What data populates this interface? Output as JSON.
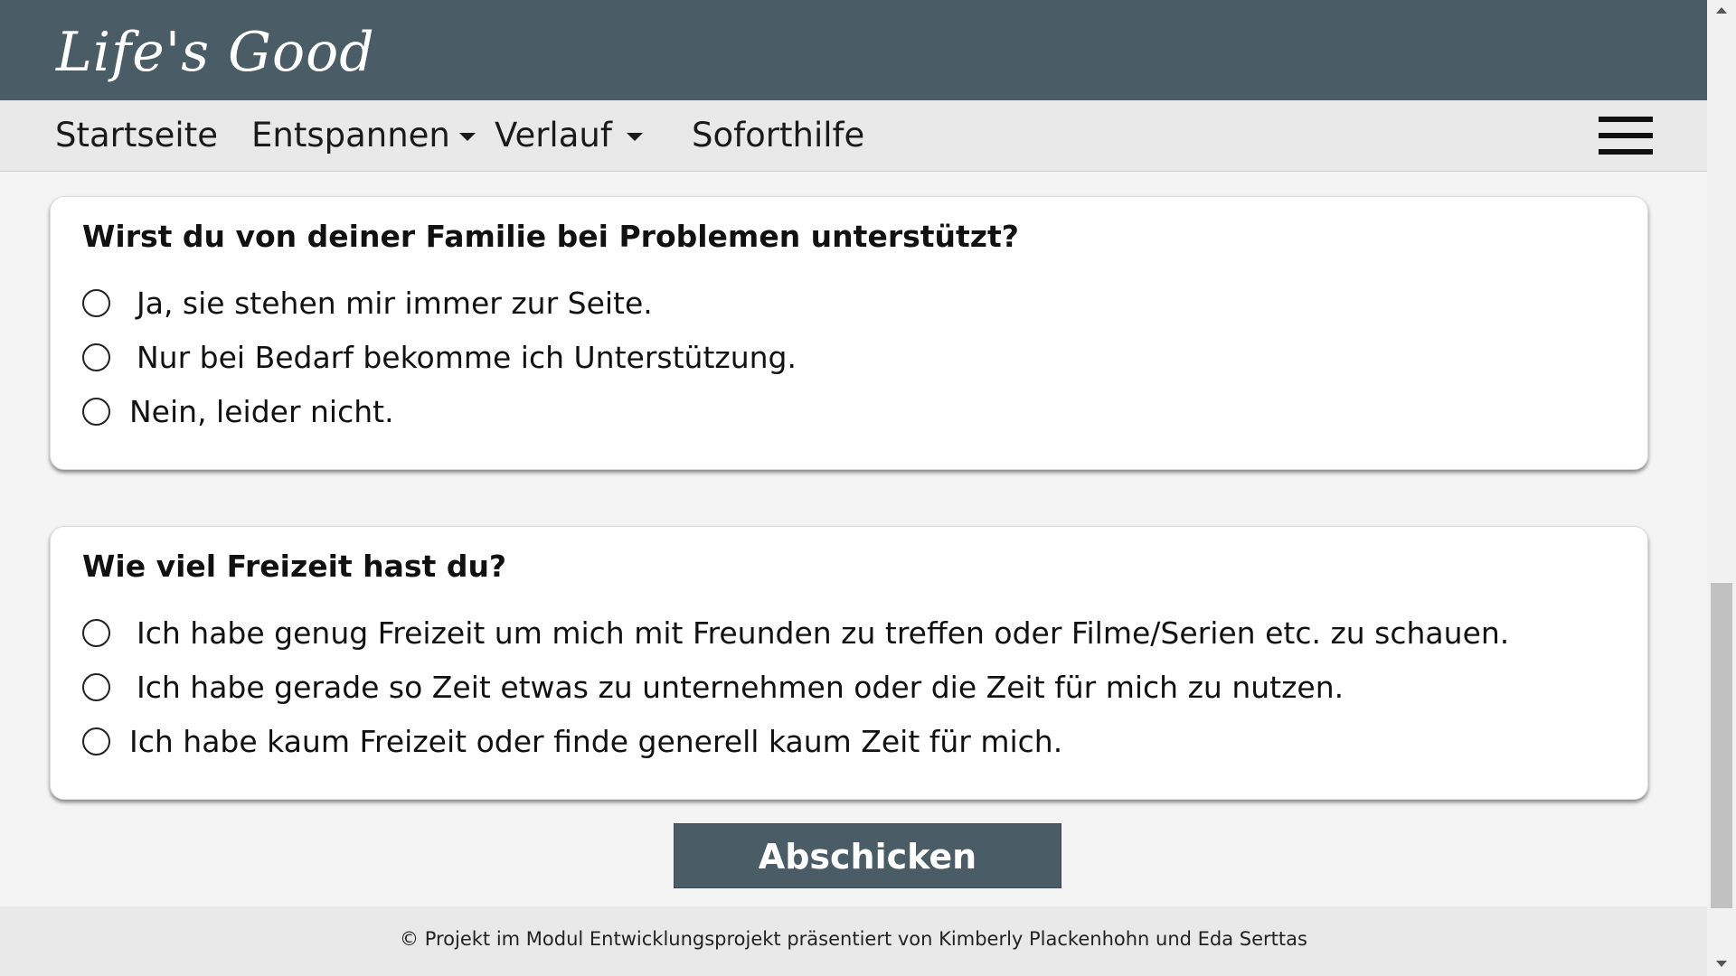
{
  "brand": {
    "logo_text": "Life's Good",
    "header_color": "#4a5d66"
  },
  "nav": {
    "items": [
      {
        "label": "Startseite",
        "has_dropdown": false
      },
      {
        "label": "Entspannen",
        "has_dropdown": true
      },
      {
        "label": "Verlauf",
        "has_dropdown": true
      },
      {
        "label": "Soforthilfe",
        "has_dropdown": false
      }
    ],
    "menu_icon": "hamburger-menu-icon"
  },
  "questions": [
    {
      "title": "Wirst du von deiner Familie bei Problemen unterstützt?",
      "options": [
        {
          "label": "Ja, sie stehen mir immer zur Seite.",
          "selected": false
        },
        {
          "label": "Nur bei Bedarf bekomme ich Unterstützung.",
          "selected": false
        },
        {
          "label": "Nein, leider nicht.",
          "selected": false
        }
      ]
    },
    {
      "title": "Wie viel Freizeit hast du?",
      "options": [
        {
          "label": "Ich habe genug Freizeit um mich mit Freunden zu treffen oder Filme/Serien etc. zu schauen.",
          "selected": false
        },
        {
          "label": "Ich habe gerade so Zeit etwas zu unternehmen oder die Zeit für mich zu nutzen.",
          "selected": false
        },
        {
          "label": "Ich habe kaum Freizeit oder finde generell kaum Zeit für mich.",
          "selected": false
        }
      ]
    }
  ],
  "submit": {
    "label": "Abschicken"
  },
  "footer": {
    "text": "© Projekt im Modul Entwicklungsprojekt präsentiert von Kimberly Plackenhohn und Eda Serttas"
  }
}
